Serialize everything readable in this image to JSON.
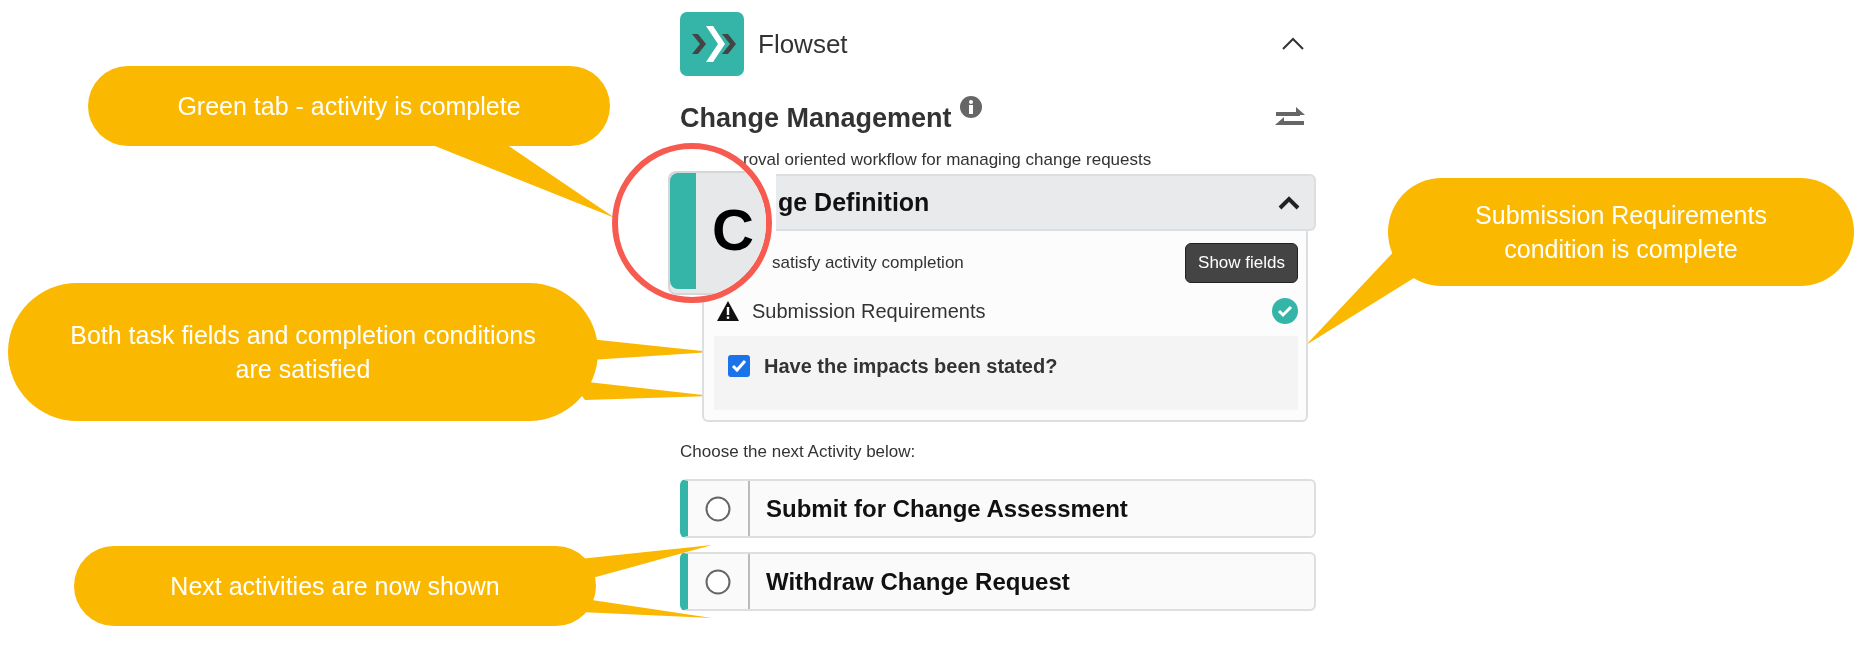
{
  "app": {
    "name": "Flowset",
    "expanded": true
  },
  "workflow": {
    "title": "Change Management",
    "description": "roval oriented workflow for managing change requests"
  },
  "activity": {
    "title": "ge Definition",
    "complete": true,
    "expanded": true,
    "instruction": "satisfy activity completion",
    "show_fields_button": "Show fields",
    "conditions": [
      {
        "name": "Submission Requirements",
        "satisfied": true,
        "fields": [
          {
            "label": "Have the impacts been stated?",
            "checked": true
          }
        ]
      }
    ]
  },
  "next_activities": {
    "prompt": "Choose the next Activity below:",
    "items": [
      {
        "label": "Submit for Change Assessment",
        "selected": false
      },
      {
        "label": "Withdraw Change Request",
        "selected": false
      }
    ]
  },
  "magnifier": {
    "letter": "C"
  },
  "callouts": [
    {
      "text": "Green tab - activity is complete"
    },
    {
      "text": "Both task fields and completion conditions are satisfied"
    },
    {
      "text": "Submission Requirements condition is complete"
    },
    {
      "text": "Next activities are now shown"
    }
  ]
}
